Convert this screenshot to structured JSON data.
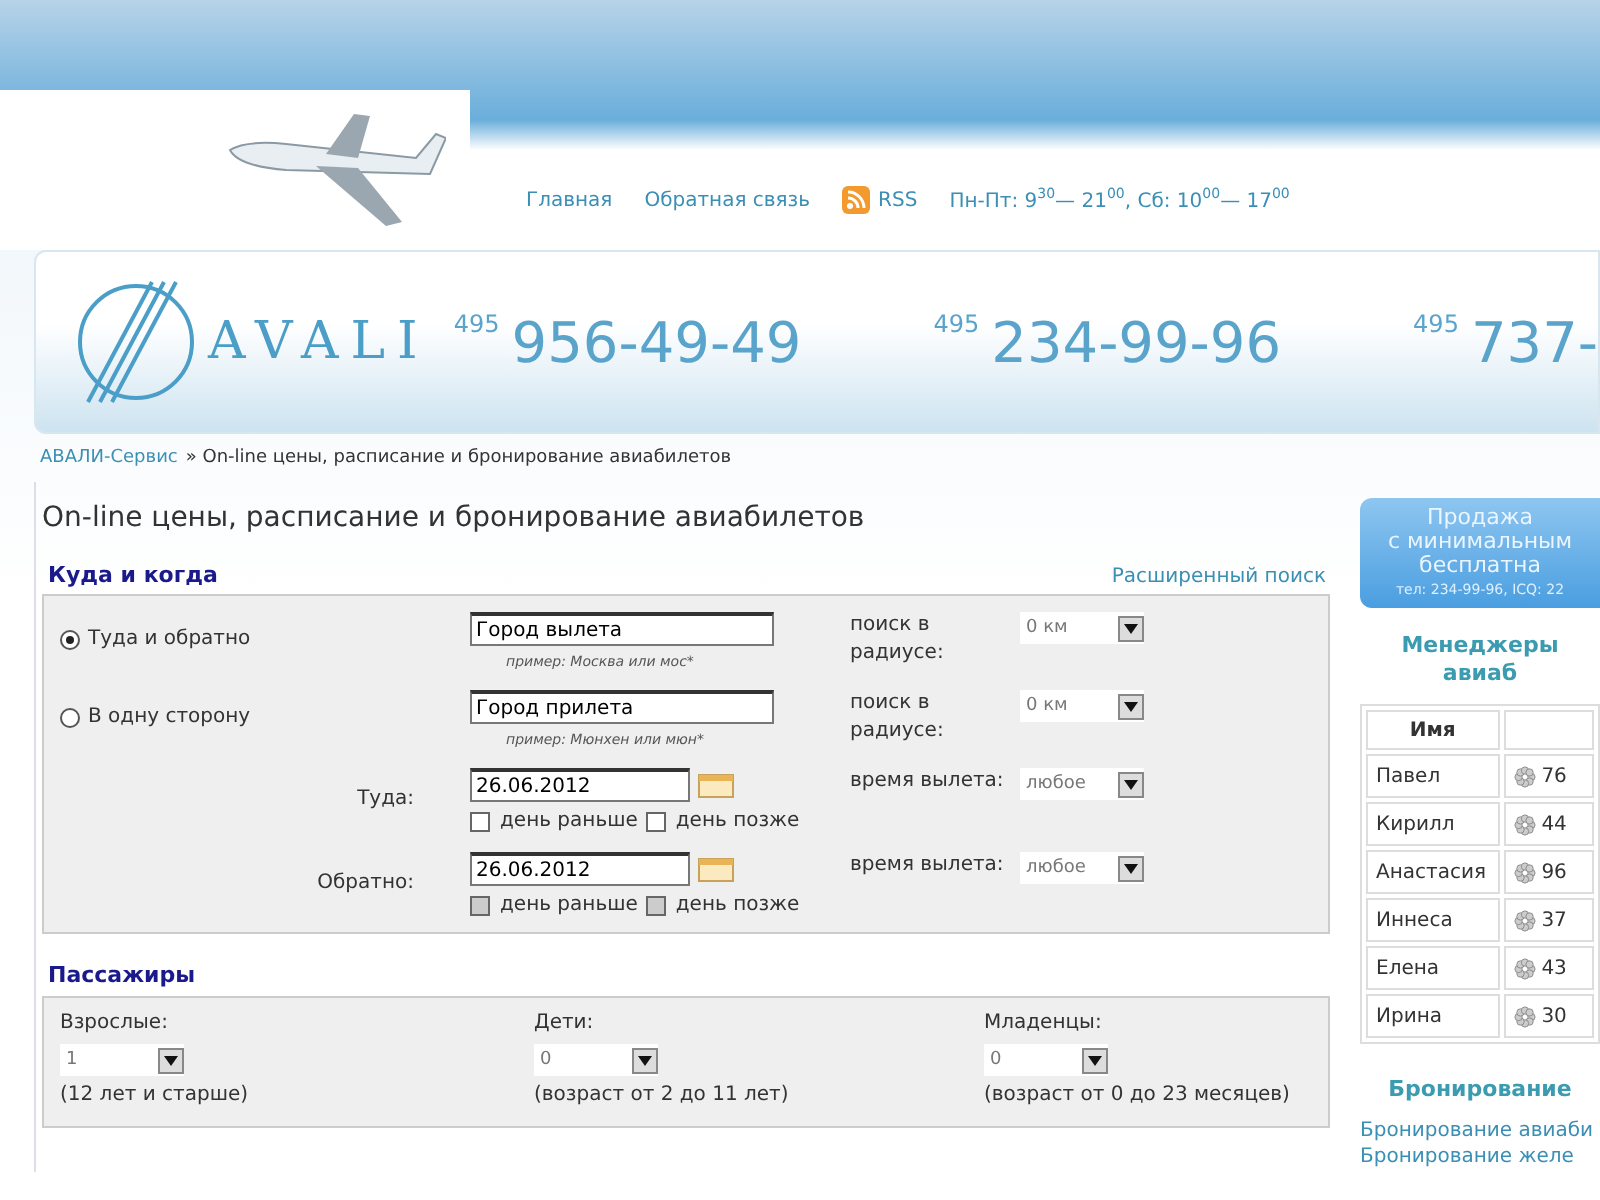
{
  "nav": [
    {
      "label": "Главная",
      "kind": "link"
    },
    {
      "label": "Обратная связь",
      "kind": "link"
    },
    {
      "label": "RSS",
      "kind": "rss"
    }
  ],
  "hours": "Пн-Пт: 9$^{30}$— 21$^{00}$, Сб: 10$^{00}$— 17$^{00}$",
  "logo": "AVALI",
  "phones": [
    {
      "code": "495",
      "number": "956-49-49"
    },
    {
      "code": "495",
      "number": "234-99-96"
    },
    {
      "code": "495",
      "number": "737-"
    }
  ],
  "breadcrumb": {
    "link": "АВАЛИ-Сервис",
    "rest": "» On-line цены, расписание и бронирование авиабилетов"
  },
  "page_title": "On-line цены, расписание и бронирование авиабилетов",
  "search": {
    "heading": "Куда и когда",
    "advanced_link": "Расширенный поиск",
    "trip_types": [
      {
        "label": "Туда и обратно",
        "selected": true
      },
      {
        "label": "В одну сторону",
        "selected": false
      }
    ],
    "cities": [
      {
        "value": "Город вылета",
        "hint": "пример: Москва или мос*",
        "radius_label": "поиск в радиусе:",
        "radius": "0 км"
      },
      {
        "value": "Город прилета",
        "hint": "пример: Мюнхен или мюн*",
        "radius_label": "поиск в радиусе:",
        "radius": "0 км"
      }
    ],
    "dates": [
      {
        "label": "Туда:",
        "value": "26.06.2012",
        "time_label": "время вылета:",
        "time": "любое",
        "options": [
          {
            "label": "день раньше",
            "checked": false,
            "disabled": false
          },
          {
            "label": "день позже",
            "checked": false,
            "disabled": false
          }
        ]
      },
      {
        "label": "Обратно:",
        "value": "26.06.2012",
        "time_label": "время вылета:",
        "time": "любое",
        "options": [
          {
            "label": "день раньше",
            "checked": false,
            "disabled": true
          },
          {
            "label": "день позже",
            "checked": false,
            "disabled": true
          }
        ]
      }
    ]
  },
  "passengers": {
    "heading": "Пассажиры",
    "groups": [
      {
        "label": "Взрослые:",
        "value": "1",
        "note": "(12 лет и старше)"
      },
      {
        "label": "Дети:",
        "value": "0",
        "note": "(возраст от 2 до 11 лет)"
      },
      {
        "label": "Младенцы:",
        "value": "0",
        "note": "(возраст от 0 до 23 месяцев)"
      }
    ]
  },
  "promo": {
    "lines": [
      "Продажа",
      "с минимальным",
      "бесплатна"
    ],
    "contact": "тел: 234-99-96, ICQ: 22"
  },
  "managers": {
    "heading_lines": [
      "Менеджеры",
      "авиаб"
    ],
    "columns": [
      "Имя"
    ],
    "rows": [
      {
        "name": "Павел",
        "icq": "76"
      },
      {
        "name": "Кирилл",
        "icq": "44"
      },
      {
        "name": "Анастасия",
        "icq": "96"
      },
      {
        "name": "Иннеса",
        "icq": "37"
      },
      {
        "name": "Елена",
        "icq": "43"
      },
      {
        "name": "Ирина",
        "icq": "30"
      }
    ]
  },
  "booking": {
    "heading": "Бронирование",
    "links": [
      "Бронирование авиаби",
      "Бронирование желе"
    ]
  }
}
